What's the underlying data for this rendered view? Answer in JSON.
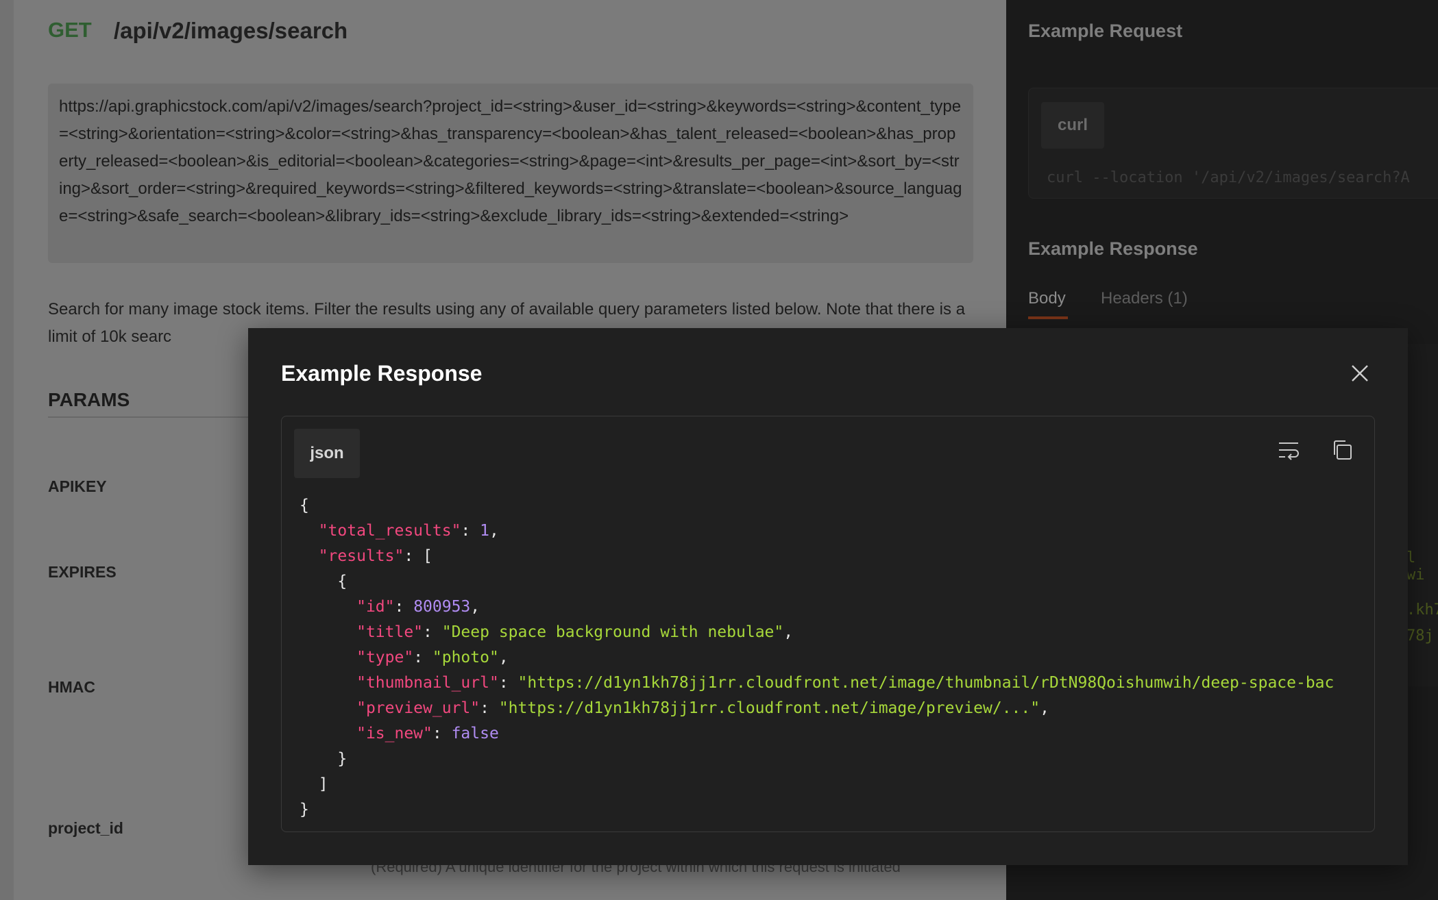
{
  "endpoint": {
    "method": "GET",
    "path": "/api/v2/images/search",
    "url": "https://api.graphicstock.com/api/v2/images/search?project_id=<string>&user_id=<string>&keywords=<string>&content_type=<string>&orientation=<string>&color=<string>&has_transparency=<boolean>&has_talent_released=<boolean>&has_property_released=<boolean>&is_editorial=<boolean>&categories=<string>&page=<int>&results_per_page=<int>&sort_by=<string>&sort_order=<string>&required_keywords=<string>&filtered_keywords=<string>&translate=<boolean>&source_language=<string>&safe_search=<boolean>&library_ids=<string>&exclude_library_ids=<string>&extended=<string>",
    "description": "Search for many image stock items. Filter the results using any of available query parameters listed below. Note that there is a limit of 10k searc"
  },
  "params": {
    "title": "PARAMS",
    "items": [
      "APIKEY",
      "EXPIRES",
      "HMAC",
      "project_id"
    ],
    "project_id_description": "(Required) A unique identifier for the project within which this request is initiated"
  },
  "right_panel": {
    "request_title": "Example Request",
    "request_lang": "curl",
    "request_code": "curl --location '/api/v2/images/search?A",
    "response_title": "Example Response",
    "tabs": [
      "Body",
      "Headers (1)"
    ],
    "fragments": [
      "l wi",
      ".kh7",
      "78j"
    ]
  },
  "modal": {
    "title": "Example Response",
    "lang": "json",
    "json": {
      "total_results": 1,
      "id": 800953,
      "title": "Deep space background with nebulae",
      "type": "photo",
      "thumbnail_url": "https://d1yn1kh78jj1rr.cloudfront.net/image/thumbnail/rDtN98Qoishumwih/deep-space-bac",
      "preview_url": "https://d1yn1kh78jj1rr.cloudfront.net/image/preview/...",
      "is_new": "false"
    }
  },
  "colors": {
    "modal_bg": "#202020",
    "json_key": "#f2487f",
    "json_number": "#b08cf2",
    "json_string": "#a7d83a",
    "method_get": "#2f5e31",
    "tab_underline": "#7a3418"
  },
  "icons": [
    "close-icon",
    "wrap-lines-icon",
    "copy-icon"
  ]
}
